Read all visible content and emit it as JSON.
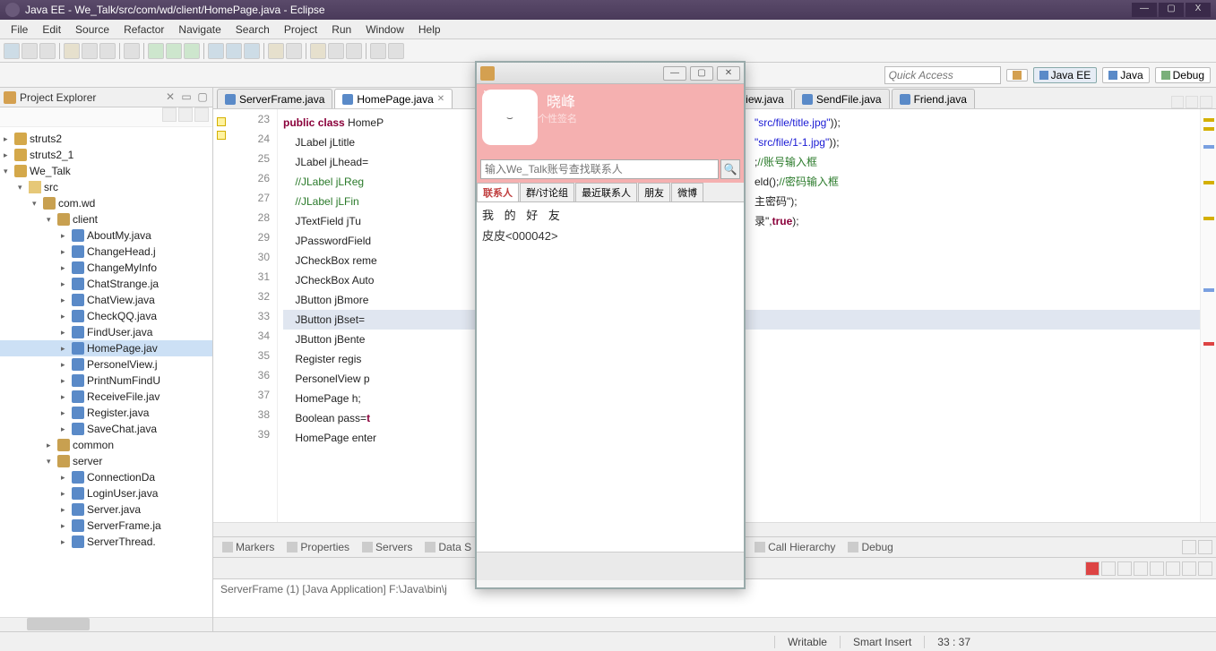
{
  "window": {
    "title": "Java EE - We_Talk/src/com/wd/client/HomePage.java - Eclipse",
    "min": "—",
    "max": "▢",
    "close": "X"
  },
  "menu": [
    "File",
    "Edit",
    "Source",
    "Refactor",
    "Navigate",
    "Search",
    "Project",
    "Run",
    "Window",
    "Help"
  ],
  "quickaccess": {
    "placeholder": "Quick Access"
  },
  "perspectives": {
    "javaee": "Java EE",
    "java": "Java",
    "debug": "Debug"
  },
  "explorer": {
    "title": "Project Explorer",
    "x": "✕",
    "items": [
      {
        "d": 0,
        "t": "▸",
        "i": "prj",
        "l": "struts2"
      },
      {
        "d": 0,
        "t": "▸",
        "i": "prj",
        "l": "struts2_1"
      },
      {
        "d": 0,
        "t": "▾",
        "i": "prjr",
        "l": "We_Talk"
      },
      {
        "d": 1,
        "t": "▾",
        "i": "fld",
        "l": "src"
      },
      {
        "d": 2,
        "t": "▾",
        "i": "pkg",
        "l": "com.wd"
      },
      {
        "d": 3,
        "t": "▾",
        "i": "pkg",
        "l": "client"
      },
      {
        "d": 4,
        "t": "▸",
        "i": "java",
        "l": "AboutMy.java"
      },
      {
        "d": 4,
        "t": "▸",
        "i": "java",
        "l": "ChangeHead.j"
      },
      {
        "d": 4,
        "t": "▸",
        "i": "java",
        "l": "ChangeMyInfo"
      },
      {
        "d": 4,
        "t": "▸",
        "i": "java",
        "l": "ChatStrange.ja"
      },
      {
        "d": 4,
        "t": "▸",
        "i": "java",
        "l": "ChatView.java"
      },
      {
        "d": 4,
        "t": "▸",
        "i": "java",
        "l": "CheckQQ.java"
      },
      {
        "d": 4,
        "t": "▸",
        "i": "java",
        "l": "FindUser.java"
      },
      {
        "d": 4,
        "t": "▸",
        "i": "java",
        "l": "HomePage.jav",
        "sel": true
      },
      {
        "d": 4,
        "t": "▸",
        "i": "java",
        "l": "PersonelView.j"
      },
      {
        "d": 4,
        "t": "▸",
        "i": "java",
        "l": "PrintNumFindU"
      },
      {
        "d": 4,
        "t": "▸",
        "i": "java",
        "l": "ReceiveFile.jav"
      },
      {
        "d": 4,
        "t": "▸",
        "i": "java",
        "l": "Register.java"
      },
      {
        "d": 4,
        "t": "▸",
        "i": "java",
        "l": "SaveChat.java"
      },
      {
        "d": 3,
        "t": "▸",
        "i": "pkg",
        "l": "common"
      },
      {
        "d": 3,
        "t": "▾",
        "i": "pkg",
        "l": "server"
      },
      {
        "d": 4,
        "t": "▸",
        "i": "java",
        "l": "ConnectionDa"
      },
      {
        "d": 4,
        "t": "▸",
        "i": "java",
        "l": "LoginUser.java"
      },
      {
        "d": 4,
        "t": "▸",
        "i": "java",
        "l": "Server.java"
      },
      {
        "d": 4,
        "t": "▸",
        "i": "java",
        "l": "ServerFrame.ja"
      },
      {
        "d": 4,
        "t": "▸",
        "i": "java",
        "l": "ServerThread."
      }
    ]
  },
  "editor": {
    "tabs": [
      {
        "l": "ServerFrame.java"
      },
      {
        "l": "HomePage.java",
        "active": true
      },
      {
        "l": "iew.java"
      },
      {
        "l": "SendFile.java"
      },
      {
        "l": "Friend.java"
      }
    ],
    "lines": [
      {
        "n": 23,
        "html": "<span class='kw'>public</span> <span class='kw'>class</span> HomeP"
      },
      {
        "n": 24,
        "html": "    JLabel jLtitle"
      },
      {
        "n": 25,
        "html": "    JLabel jLhead="
      },
      {
        "n": 26,
        "html": "    <span class='cm'>//JLabel jLReg</span>"
      },
      {
        "n": 27,
        "html": "    <span class='cm'>//JLabel jLFin</span>"
      },
      {
        "n": 28,
        "html": "    JTextField jTu"
      },
      {
        "n": 29,
        "html": "    JPasswordField"
      },
      {
        "n": 30,
        "html": "    JCheckBox reme"
      },
      {
        "n": 31,
        "html": "    JCheckBox Auto"
      },
      {
        "n": 32,
        "html": "    JButton jBmore"
      },
      {
        "n": 33,
        "html": "    JButton jBset=",
        "hl": true
      },
      {
        "n": 34,
        "html": "    JButton jBente"
      },
      {
        "n": 35,
        "html": "    Register regis"
      },
      {
        "n": 36,
        "html": "    PersonelView p"
      },
      {
        "n": 37,
        "html": "    HomePage h;"
      },
      {
        "n": 38,
        "html": "    Boolean pass=<span class='kw'>t</span>"
      },
      {
        "n": 39,
        "html": "    HomePage enter"
      }
    ],
    "rightlines": [
      "",
      "<span class='str'>\"src/file/title.jpg\"</span>));",
      "<span class='str'>\"src/file/1-1.jpg\"</span>));",
      "",
      "",
      ";<span class='cm'>//账号输入框</span>",
      "eld();<span class='cm'>//密码输入框</span>",
      "主密码\"</span>);",
      "录\"</span>,<span class='kw'>true</span>);",
      "",
      "",
      "",
      "",
      "",
      "",
      "",
      ""
    ]
  },
  "bottom": {
    "tabs": [
      "Markers",
      "Properties",
      "Servers",
      "Data S",
      "Call Hierarchy",
      "Debug"
    ],
    "console": "ServerFrame (1) [Java Application] F:\\Java\\bin\\j"
  },
  "status": {
    "writable": "Writable",
    "insert": "Smart Insert",
    "pos": "33 : 37"
  },
  "app": {
    "name": "We_Talk",
    "user": "晓峰",
    "sig": "个性签名",
    "face": "⌣",
    "search_ph": "输入We_Talk账号查找联系人",
    "tabs": [
      "联系人",
      "群/讨论组",
      "最近联系人",
      "朋友",
      "微博"
    ],
    "group": "我 的 好 友",
    "friend": "皮皮<000042>",
    "min": "—",
    "max": "▢",
    "close": "✕"
  }
}
